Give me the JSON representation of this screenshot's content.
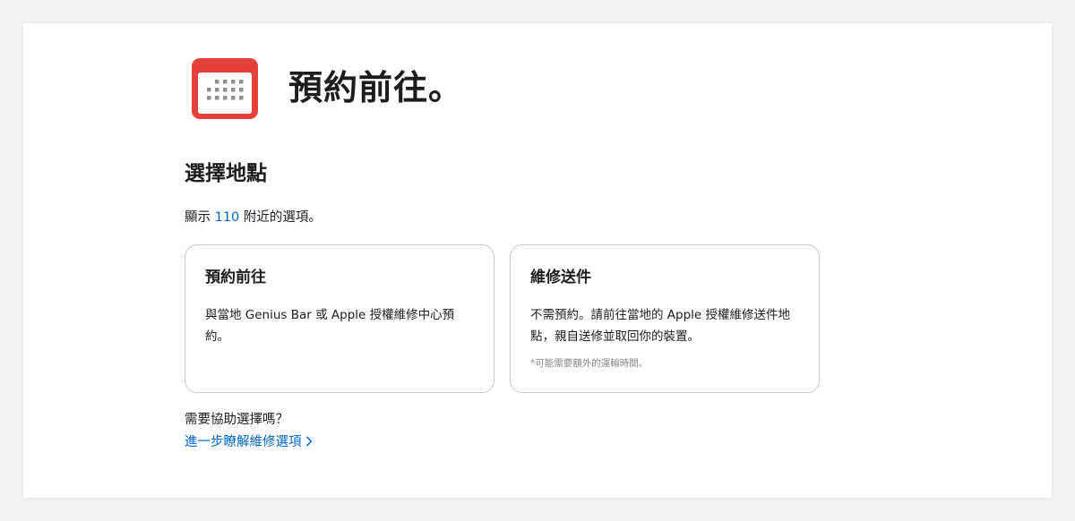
{
  "header": {
    "title": "預約前往。",
    "icon": "calendar-icon"
  },
  "location": {
    "heading": "選擇地點",
    "nearby_prefix": "顯示",
    "zip": "110",
    "nearby_suffix": "附近的選項。"
  },
  "options": [
    {
      "title": "預約前往",
      "description": "與當地 Genius Bar 或 Apple 授權維修中心預約。"
    },
    {
      "title": "維修送件",
      "description": "不需預約。請前往當地的 Apple 授權維修送件地點，親自送修並取回你的裝置。",
      "note": "*可能需要額外的運輸時間。"
    }
  ],
  "help": {
    "question": "需要協助選擇嗎？",
    "link": "進一步瞭解維修選項",
    "link_icon": "chevron-right-icon"
  },
  "colors": {
    "accent_link": "#0066cc",
    "calendar_red": "#e3413a",
    "card_border": "#c8c8cc"
  }
}
